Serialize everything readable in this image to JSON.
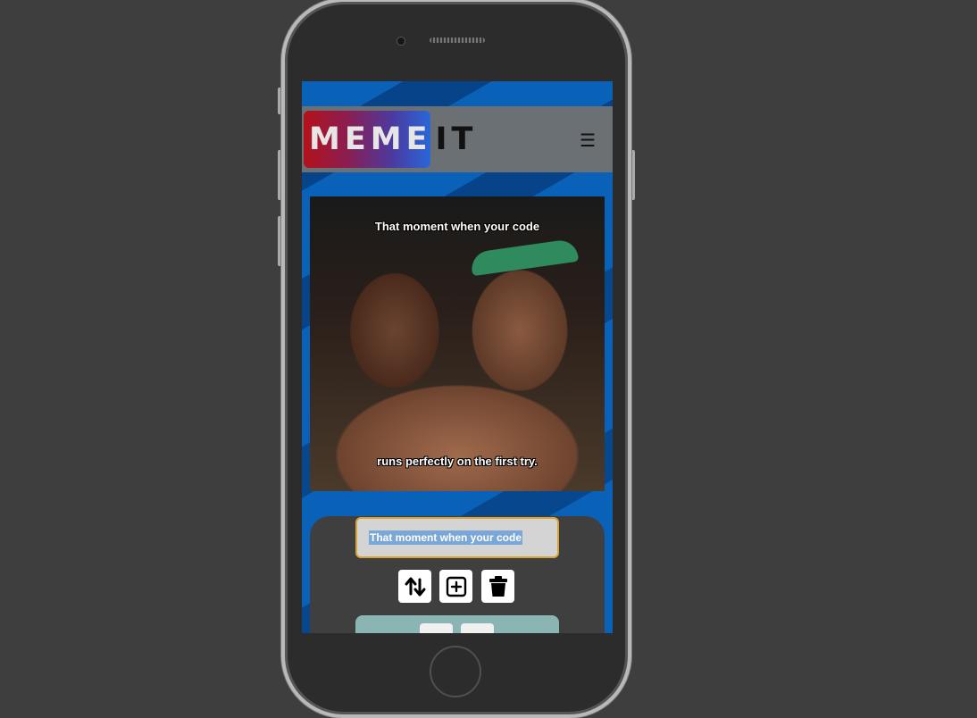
{
  "header": {
    "logo_word1": "MEME",
    "logo_word2": "IT",
    "menu_glyph": "☰"
  },
  "meme": {
    "top_text": "That moment when your code",
    "bottom_text": "runs perfectly on the first try."
  },
  "editor": {
    "text_value": "That moment when your code",
    "buttons": [
      {
        "icon": "swap-vertical-icon"
      },
      {
        "icon": "add-box-icon"
      },
      {
        "icon": "trash-icon"
      }
    ]
  },
  "colors": {
    "accent": "#d9a437",
    "navbar": "#6b7075",
    "panel": "#3f3f3f",
    "subpanel": "#8ab5b3"
  }
}
